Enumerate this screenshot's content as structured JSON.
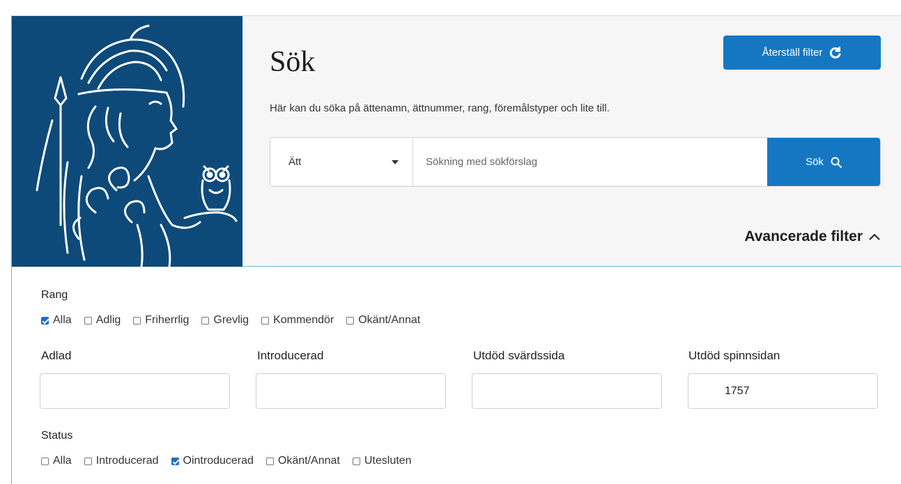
{
  "page": {
    "title": "Sök",
    "description": "Här kan du söka på ättenamn, ättnummer, rang, föremålstyper och lite till.",
    "reset_label": "Återställ filter",
    "advanced_label": "Avancerade filter"
  },
  "search": {
    "select_value": "Ätt",
    "placeholder": "Sökning med sökförslag",
    "value": "",
    "button_label": "Sök"
  },
  "rang": {
    "label": "Rang",
    "options": [
      {
        "label": "Alla",
        "checked": true
      },
      {
        "label": "Adlig",
        "checked": false
      },
      {
        "label": "Friherrlig",
        "checked": false
      },
      {
        "label": "Grevlig",
        "checked": false
      },
      {
        "label": "Kommendör",
        "checked": false
      },
      {
        "label": "Okänt/Annat",
        "checked": false
      }
    ]
  },
  "fields": [
    {
      "label": "Adlad",
      "value": ""
    },
    {
      "label": "Introducerad",
      "value": ""
    },
    {
      "label": "Utdöd svärdssida",
      "value": ""
    },
    {
      "label": "Utdöd spinnsidan",
      "value": "1757"
    }
  ],
  "status": {
    "label": "Status",
    "options": [
      {
        "label": "Alla",
        "checked": false
      },
      {
        "label": "Introducerad",
        "checked": false
      },
      {
        "label": "Ointroducerad",
        "checked": true
      },
      {
        "label": "Okänt/Annat",
        "checked": false
      },
      {
        "label": "Utesluten",
        "checked": false
      }
    ]
  },
  "colors": {
    "logo_bg": "#0d4a7a",
    "accent": "#1577c2",
    "checkbox_on": "#1e6ec8"
  },
  "icons": {
    "logo": "athena-with-owl-logo",
    "reset": "refresh-icon",
    "search": "search-icon",
    "dropdown": "caret-down-icon",
    "advanced": "chevron-up-icon"
  }
}
